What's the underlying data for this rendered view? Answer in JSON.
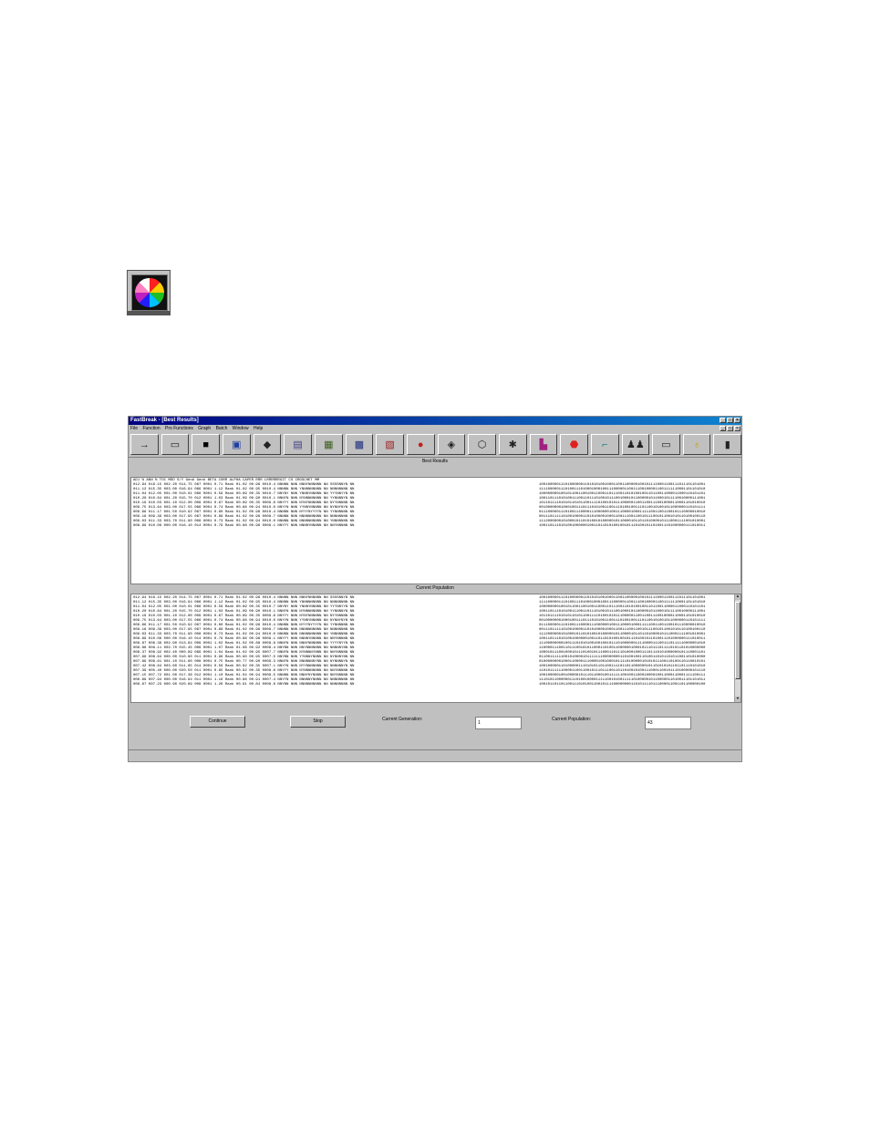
{
  "window": {
    "title": "FastBreak - [Best Results]"
  },
  "menu": [
    "File",
    "Function",
    "Pro Functions",
    "Graph",
    "Batch",
    "Window",
    "Help"
  ],
  "toolbar_icons": [
    "arrow-icon",
    "open-folder-icon",
    "save-disk-icon",
    "blue-book-icon",
    "eraser-icon",
    "document-icon",
    "chart-icon",
    "calendar-icon",
    "report-icon",
    "color-wheel-icon",
    "diamond-icon",
    "gear-octagon-icon",
    "scatter-icon",
    "bar-chart-icon",
    "stop-sign-icon",
    "faucet-icon",
    "people-icon",
    "bus-icon",
    "light-bulb-icon",
    "exit-door-icon"
  ],
  "best_results": {
    "label": "Best Results",
    "header": "ADJ %  ANN %   TOC    MDD  S/Y Gen# Gen#   BETA  CORR  ALPHA CAPER RRR LRRRRRRGIT CS CRGSCHET MM",
    "rows": [
      {
        "left": "012.94 016.15 002.20 014.75 067 0001 0.71 Rank  01.02 00.96 0010.4 NNNNN NNN NNNYNNNNNN NN SSSSNNYN NN",
        "right": "1001000001110100000011010101001000110011000001001011110001100111011101101001"
      },
      {
        "left": "011.12 015.35 003.00 016.94 066 0001 1.12 Rank  01.02 00.95 0010.4 NNNNN NNN YNNNNNNNNN NN NNNNNNNN NN",
        "right": "1111000001110100111010001000100111000001100111001000011001111110001101101010"
      },
      {
        "left": "011.04 012.05 001.00 010.01 066 0001 0.59 Rank  00.89 00.35 0010.7 NNYNY NNN YNNNYNNNNN NN YYYNNYYN NN",
        "right": "1000000001001011001100100110001101110011010100100110110011000011000110101101"
      },
      {
        "left": "010.20 010.84 001.20 015.70 012 0001 1.03 Rank  01.09 00.90 0010.1 NNNYN NNN NYNNNNNNNN NN YYNNNNYN NN",
        "right": "1001101110101001110011011101001011100100010110000010110001011110010000111001"
      },
      {
        "left": "010.19 010.03 001.10 012.00 009 0001 0.67 Rank  00.89 00.35 0009.8 NNYYY NNN NYNYNNNNNN NN NYYNNNNN NN",
        "right": "1011011110101011010110011110100101011100000110011001110010000110001101010010"
      },
      {
        "left": "009.75 013.64 003.00 017.55 066 0001 0.74 Rank  00.88 00.94 0010.0 NNYYN NNN YYNNYNNNNN NN NYNNYNYN NN",
        "right": "0010000000100010011101110101001100111010010011101100101001011000000110101111"
      },
      {
        "left": "009.66 011.17 001.50 010.92 067 0001 0.80 Rank  01.02 00.96 0010.4 NNNNN NNN NYYYNYYYYN NN YYNNNNNN NN",
        "right": "0111000001110100111000011100000010011100001000111110011001100101110000010010"
      },
      {
        "left": "009.16 009.39 003.00 017.95 067 0001 0.89 Rank  01.02 00.96 0008.7 NNNNN NNN NNNNNNNNNN NN NNNNNNNN NN",
        "right": "0011101111101001000011010100001000110011100110010111001011001010110100100110"
      },
      {
        "left": "009.03 011.33 003.70 011.90 008 0001 0.73 Rank  01.02 00.94 0010.0 NNNNN NNN NNNNNNNNNN NN YNNNNNNN NN",
        "right": "1112000000101000101101010010100000101100001011011010000101110001111001010001"
      },
      {
        "left": "008.89 010.06 000.00 016.10 014 0001 0.79 Rank  00.88 00.96 0009.1 NNYYY NNN NNNNYNNNNN NN NNYNNNNN NN",
        "right": "1001101110101001000000100110110101001001011101001011010011101000000111010011"
      }
    ]
  },
  "current_population": {
    "label": "Current Population",
    "rows": [
      {
        "left": "012.94 016.15 002.20 014.75 067 0001 0.71 Rank  01.02 00.96 0010.4 NNNNN NNN NNNYNNNNNN NN SSSSNNYN NN",
        "right": "1001000001110100000011010101001000110011000001001011110001100111011101101001"
      },
      {
        "left": "011.12 015.35 003.00 016.94 066 0001 1.12 Rank  01.02 00.95 0010.4 NNNNN NNN YNNNNNNNNN NN NNNNNNNN NN",
        "right": "1111000001110100111010001000100111000001100111001000011001111110001101101010"
      },
      {
        "left": "011.04 012.05 001.00 010.01 066 0001 0.59 Rank  00.89 00.35 0010.7 NNYNY NNN YNNNYNNNNN NN YYYNNYYN NN",
        "right": "1000000001001011001100100110001101110011010100100110110011000011000110101101"
      },
      {
        "left": "010.20 010.84 001.20 015.70 012 0001 1.03 Rank  01.09 00.90 0010.1 NNNYN NNN NYNNNNNNNN NN YYNNNNYN NN",
        "right": "1001101110101001110011011101001011100100010110000010110001011110010000111001"
      },
      {
        "left": "010.19 010.03 001.10 012.00 009 0001 0.67 Rank  00.89 00.35 0009.8 NNYYY NNN NYNYNNNNNN NN NYYNNNNN NN",
        "right": "1011011110101011010110011110100101011100000110011001110010000110001101010010"
      },
      {
        "left": "009.75 013.64 003.00 017.55 066 0001 0.74 Rank  00.88 00.94 0010.0 NNYYN NNN YYNNYNNNNN NN NYNNYNYN NN",
        "right": "0010000000100010011101110101001100111010010011101100101001011000000110101111"
      },
      {
        "left": "009.66 011.17 001.50 010.92 067 0001 0.80 Rank  01.02 00.96 0010.4 NNNNN NNN NYYYNYYYYN NN YYNNNNNN NN",
        "right": "0111000001110100111000011100000010011100001000111110011001100101110000010010"
      },
      {
        "left": "009.16 009.39 003.00 017.95 067 0001 0.89 Rank  01.02 00.96 0008.7 NNNNN NNN NNNNNNNNNN NN NNNNNNNN NN",
        "right": "0011101111101001000011010100001000110011100110010111001011001010110100100110"
      },
      {
        "left": "009.03 011.33 003.70 011.90 008 0001 0.73 Rank  01.02 00.94 0010.0 NNNNN NNN NNNNNNNNNN NN YNNNNNNN NN",
        "right": "1112000000101000101101010010100000101100001011011010000101110001111001010001"
      },
      {
        "left": "008.89 010.06 000.00 016.10 014 0001 0.79 Rank  00.88 00.96 0009.1 NNYYY NNN NNNNYNNNNN NN NNYNNNNN NN",
        "right": "1001101110101001000000100110110101001001011101001011010011101000000111010011"
      },
      {
        "left": "008.87 008.39 002.90 013.84 009 0001 1.02 Rank  01.02 00.88 0009.8 NNNYN NNN NNNYNNNNNN NN YYYYNYYN NN",
        "right": "1110000000010011101010100100100101110100000011110000111001110111110000001010"
      },
      {
        "left": "008.88 009.11 002.70 015.45 009 0001 1.07 Rank  01.08 00.92 0008.4 NNYNN NNN NNYNNNNNNN NN NNNNNYNN NN",
        "right": "1100001110011011100101011000110100110000001000101110111011110101101010000000"
      },
      {
        "left": "008.37 008.92 002.40 000.89 069 0001 1.04 Rank  01.02 00.95 0007.7 NNNYN NNN NYNNNNYNNN NN NNYNNNNN NN",
        "right": "1000101110010001011101001011100011011101000100011101110101000000101110001101"
      },
      {
        "left": "007.98 008.64 000.00 010.90 011 0001 0.96 Rank  00.90 00.95 0007.5 NNYNN NNN YYNNNYNNNN NN NYNNNYNN NN",
        "right": "0110011111100101000010111111100000000110100100110100110101101011001101010000"
      },
      {
        "left": "007.89 009.61 001.10 011.60 008 0001 0.75 Rank  00.77 00.90 0009.3 NNNYN NNN NNNNNNNYNN NN NYNNNNYN NN",
        "right": "0100000000100011000011100001001000101111010000010101011100110100110110010101"
      },
      {
        "left": "007.42 008.64 003.60 011.85 014 0001 0.56 Rank  00.82 00.35 0007.1 NNYYN NNN NYYNNNNNNN NN NNNNNNYN NN",
        "right": "1001000001101000001110101011011001111011011000000101101010101101101110101010"
      },
      {
        "left": "007.39 005.40 000.00 020.50 011 0001 0.65 Rank  00.92 00.35 0008.6 NNYYY NNN NYNNNNNNNN NN NNYNNNNN NN",
        "right": "1101011111100001100110010111011100110110100101001110001100101110100000101110"
      },
      {
        "left": "007.15 007.72 001.00 017.36 012 0001 1.10 Rank  01.04 00.94 0008.5 NNNNN NNN NNNYNYNNNN NN NNYNNNNN NN",
        "right": "1001000001001000001011101100010011111100100110001000010011000110001111100111"
      },
      {
        "left": "006.89 007.94 000.00 016.94 011 0001 1.16 Rank  00.86 00.91 0007.4 NNYYN NNN NNNNNYNNNN NN NNNNNNNN NN",
        "right": "1110101100000011101001000011111001010011111010000010110000011010011101101011"
      },
      {
        "left": "006.87 007.23 000.90 020.89 009 0001 1.26 Rank  00.91 00.84 0008.8 NNYNN NNN NNNNNNNNNN NN NNNNNNNN NN",
        "right": "1001011011011001110101001100101111000000001101011110111000011001101100000100"
      }
    ]
  },
  "controls": {
    "continue_label": "Continue",
    "stop_label": "Stop",
    "current_generation_label": "Current Generation:",
    "current_generation_value": "1",
    "current_population_label": "Current Population:",
    "current_population_value": "43"
  }
}
